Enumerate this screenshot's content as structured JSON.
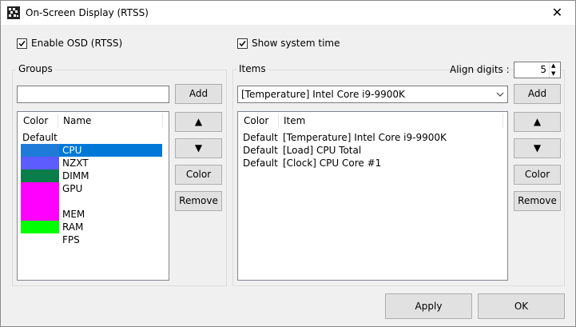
{
  "window": {
    "title": "On-Screen Display (RTSS)",
    "close_glyph": "✕"
  },
  "options": {
    "enable_osd_label": "Enable OSD (RTSS)",
    "enable_osd_checked": true,
    "show_time_label": "Show system time",
    "show_time_checked": true
  },
  "groups": {
    "title": "Groups",
    "input_value": "",
    "add_label": "Add",
    "up_label": "▲",
    "down_label": "▼",
    "color_label": "Color",
    "remove_label": "Remove",
    "columns": [
      "Color",
      "Name"
    ],
    "rows": [
      {
        "color_text": "Default",
        "name": "",
        "swatch": null,
        "selected": false
      },
      {
        "color_text": "",
        "name": "CPU",
        "swatch": "#1e7cd8",
        "selected": true
      },
      {
        "color_text": "",
        "name": "NZXT",
        "swatch": "#5c5cff",
        "selected": false
      },
      {
        "color_text": "",
        "name": "DIMM",
        "swatch": "#0a7d4a",
        "selected": false
      },
      {
        "color_text": "",
        "name": "GPU",
        "swatch": "#ff00ff",
        "selected": false
      },
      {
        "color_text": "",
        "name": "",
        "swatch": "#ff00ff",
        "selected": false
      },
      {
        "color_text": "",
        "name": "MEM",
        "swatch": "#ff00ff",
        "selected": false
      },
      {
        "color_text": "",
        "name": "RAM",
        "swatch": "#00ff00",
        "selected": false
      },
      {
        "color_text": "",
        "name": "FPS",
        "swatch": null,
        "selected": false
      }
    ]
  },
  "items": {
    "title": "Items",
    "align_label": "Align digits :",
    "align_value": "5",
    "combo_value": "[Temperature] Intel Core i9-9900K",
    "add_label": "Add",
    "up_label": "▲",
    "down_label": "▼",
    "color_label": "Color",
    "remove_label": "Remove",
    "columns": [
      "Color",
      "Item"
    ],
    "rows": [
      {
        "color_text": "Default",
        "item": "[Temperature] Intel Core i9-9900K"
      },
      {
        "color_text": "Default",
        "item": "[Load] CPU Total"
      },
      {
        "color_text": "Default",
        "item": "[Clock] CPU Core #1"
      }
    ]
  },
  "footer": {
    "apply_label": "Apply",
    "ok_label": "OK"
  },
  "colors": {
    "selection": "#0078d7",
    "button_bg": "#e1e1e1"
  }
}
